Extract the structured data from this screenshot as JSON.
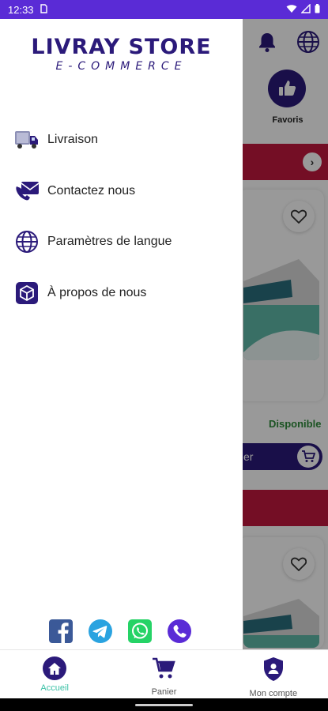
{
  "status_bar": {
    "time": "12:33",
    "left_icon": "sim-card-icon",
    "right_icons": [
      "wifi-icon",
      "signal-icon",
      "battery-icon"
    ]
  },
  "drawer": {
    "brand_title": "LIVRAY STORE",
    "brand_subtitle": "E-COMMERCE",
    "menu": [
      {
        "label": "Livraison",
        "icon": "delivery-truck-icon"
      },
      {
        "label": "Contactez nous",
        "icon": "phone-mail-icon"
      },
      {
        "label": "Paramètres de langue",
        "icon": "globe-icon"
      },
      {
        "label": "À propos de nous",
        "icon": "cube-icon"
      }
    ],
    "socials": [
      "facebook-icon",
      "telegram-icon",
      "whatsapp-icon",
      "phone-call-icon"
    ]
  },
  "background": {
    "favoris_label": "Favoris",
    "availability": "Disponible",
    "cart_button_fragment": "er"
  },
  "bottom_nav": {
    "items": [
      {
        "label": "Accueil",
        "icon": "home-icon",
        "active": true
      },
      {
        "label": "Panier",
        "icon": "cart-icon",
        "active": false
      },
      {
        "label": "Mon compte",
        "icon": "account-shield-icon",
        "active": false
      }
    ]
  },
  "colors": {
    "brand_primary": "#2b1a7a",
    "status_bar": "#5a2bd6",
    "accent_red": "#c2183f",
    "active_nav": "#3bc1a6",
    "available_green": "#2e8b3a"
  }
}
